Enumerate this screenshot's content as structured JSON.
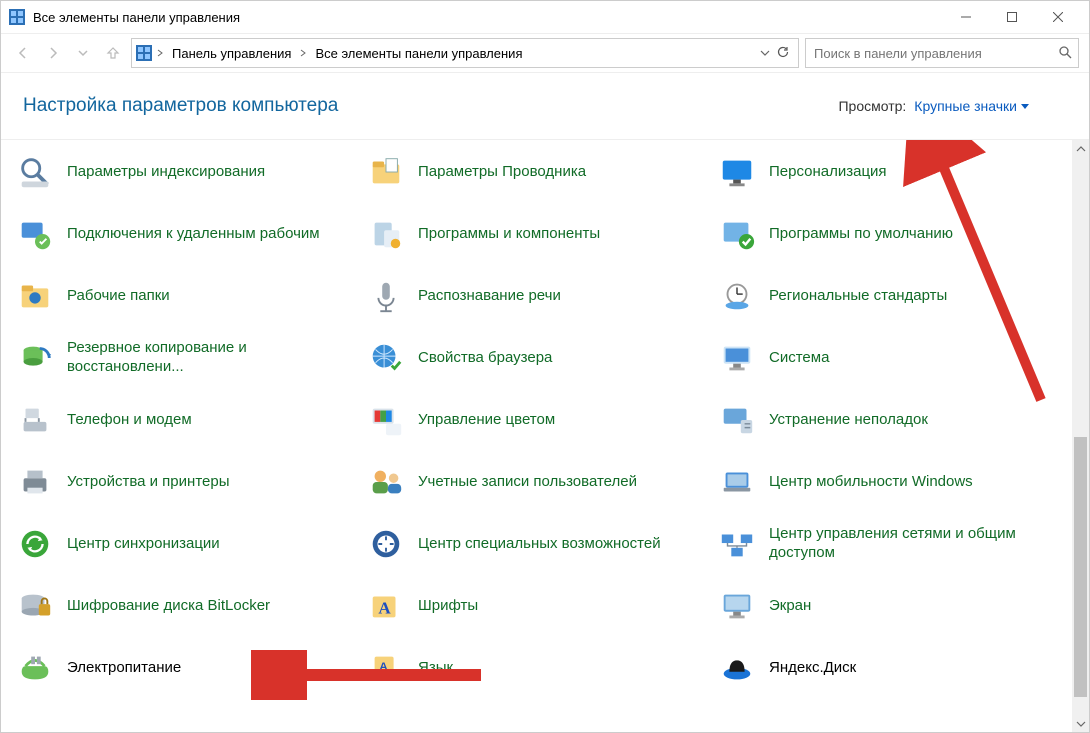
{
  "window": {
    "title": "Все элементы панели управления"
  },
  "breadcrumbs": {
    "items": [
      "Панель управления",
      "Все элементы панели управления"
    ]
  },
  "search": {
    "placeholder": "Поиск в панели управления"
  },
  "header": {
    "title": "Настройка параметров компьютера",
    "view_label": "Просмотр:",
    "view_value": "Крупные значки"
  },
  "items": [
    [
      {
        "label": "Параметры индексирования",
        "icon": "indexing"
      },
      {
        "label": "Параметры Проводника",
        "icon": "folder-options"
      },
      {
        "label": "Персонализация",
        "icon": "personalization"
      }
    ],
    [
      {
        "label": "Подключения к удаленным рабочим",
        "icon": "remote-desktop"
      },
      {
        "label": "Программы и компоненты",
        "icon": "programs-features"
      },
      {
        "label": "Программы по умолчанию",
        "icon": "default-programs"
      }
    ],
    [
      {
        "label": "Рабочие папки",
        "icon": "work-folders"
      },
      {
        "label": "Распознавание речи",
        "icon": "speech"
      },
      {
        "label": "Региональные стандарты",
        "icon": "regional"
      }
    ],
    [
      {
        "label": "Резервное копирование и восстановлени...",
        "icon": "backup"
      },
      {
        "label": "Свойства браузера",
        "icon": "internet-options"
      },
      {
        "label": "Система",
        "icon": "system"
      }
    ],
    [
      {
        "label": "Телефон и модем",
        "icon": "phone-modem"
      },
      {
        "label": "Управление цветом",
        "icon": "color-management"
      },
      {
        "label": "Устранение неполадок",
        "icon": "troubleshoot"
      }
    ],
    [
      {
        "label": "Устройства и принтеры",
        "icon": "devices-printers"
      },
      {
        "label": "Учетные записи пользователей",
        "icon": "user-accounts"
      },
      {
        "label": "Центр мобильности Windows",
        "icon": "mobility-center"
      }
    ],
    [
      {
        "label": "Центр синхронизации",
        "icon": "sync-center"
      },
      {
        "label": "Центр специальных возможностей",
        "icon": "ease-of-access"
      },
      {
        "label": "Центр управления сетями и общим доступом",
        "icon": "network-sharing"
      }
    ],
    [
      {
        "label": "Шифрование диска BitLocker",
        "icon": "bitlocker"
      },
      {
        "label": "Шрифты",
        "icon": "fonts"
      },
      {
        "label": "Экран",
        "icon": "display"
      }
    ],
    [
      {
        "label": "Электропитание",
        "icon": "power",
        "black": true
      },
      {
        "label": "Язык",
        "icon": "language"
      },
      {
        "label": "Яндекс.Диск",
        "icon": "yandex-disk",
        "black": true
      }
    ]
  ]
}
